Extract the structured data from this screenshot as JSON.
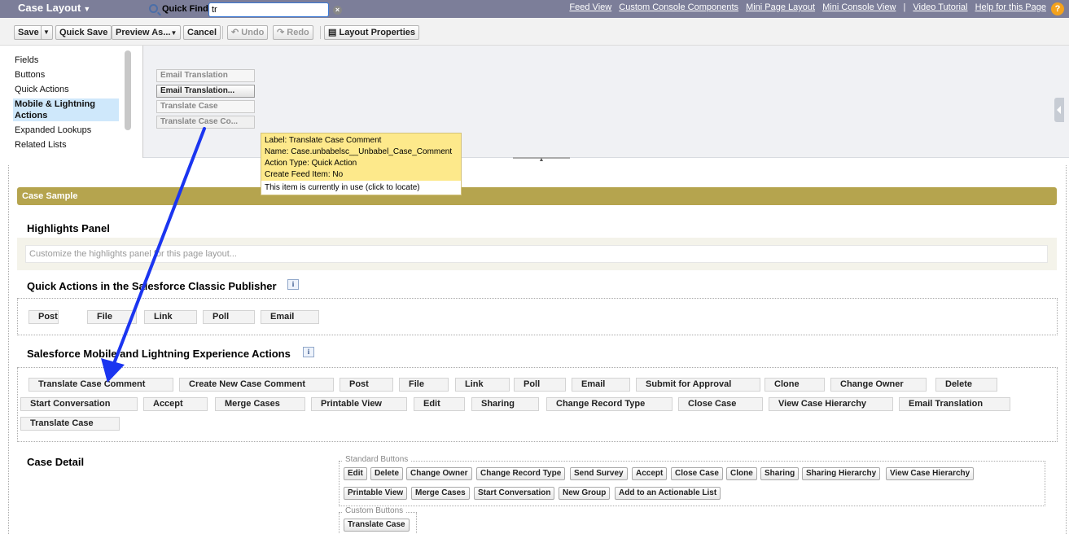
{
  "header": {
    "title": "Case Layout",
    "links": [
      "Feed View",
      "Custom Console Components",
      "Mini Page Layout",
      "Mini Console View"
    ],
    "separator": "|",
    "links2": [
      "Video Tutorial",
      "Help for this Page"
    ],
    "help_glyph": "?"
  },
  "toolbar": {
    "save": "Save",
    "quick_save": "Quick Save",
    "preview_as": "Preview As...",
    "cancel": "Cancel",
    "undo": "Undo",
    "redo": "Redo",
    "layout_properties": "Layout Properties"
  },
  "palette": {
    "categories": [
      "Fields",
      "Buttons",
      "Quick Actions",
      "Mobile & Lightning Actions",
      "Expanded Lookups",
      "Related Lists"
    ],
    "selected_category": "Mobile & Lightning Actions",
    "quick_find_label": "Quick Find",
    "quick_find_value": "tr",
    "items": [
      "Email Translation",
      "Email Translation...",
      "Translate Case",
      "Translate Case Co..."
    ]
  },
  "tooltip": {
    "label": "Label: Translate Case Comment",
    "name": "Name: Case.unbabelsc__Unbabel_Case_Comment",
    "action_type": "Action Type: Quick Action",
    "create_feed": "Create Feed Item: No",
    "footer": "This item is currently in use (click to locate)"
  },
  "layout": {
    "sample_bar": "Case Sample",
    "highlights_title": "Highlights Panel",
    "highlights_placeholder": "Customize the highlights panel for this page layout...",
    "classic_title": "Quick Actions in the Salesforce Classic Publisher",
    "classic_actions": [
      "Post",
      "File",
      "Link",
      "Poll",
      "Email"
    ],
    "mobile_title": "Salesforce Mobile and Lightning Experience Actions",
    "mobile_actions_row1": [
      "Translate Case Comment",
      "Create New Case Comment",
      "Post",
      "File",
      "Link",
      "Poll",
      "Email",
      "Submit for Approval",
      "Clone",
      "Change Owner",
      "Delete"
    ],
    "mobile_actions_row2": [
      "Start Conversation",
      "Accept",
      "Merge Cases",
      "Printable View",
      "Edit",
      "Sharing",
      "Change Record Type",
      "Close Case",
      "View Case Hierarchy",
      "Email Translation"
    ],
    "mobile_actions_row3": [
      "Translate Case"
    ],
    "detail_title": "Case Detail",
    "standard_buttons_legend": "Standard Buttons",
    "standard_buttons_row1": [
      "Edit",
      "Delete",
      "Change Owner",
      "Change Record Type",
      "Send Survey",
      "Accept",
      "Close Case",
      "Clone",
      "Sharing",
      "Sharing Hierarchy",
      "View Case Hierarchy"
    ],
    "standard_buttons_row2": [
      "Printable View",
      "Merge Cases",
      "Start Conversation",
      "New Group",
      "Add to an Actionable List"
    ],
    "custom_buttons_legend": "Custom Buttons",
    "custom_buttons": [
      "Translate Case"
    ]
  },
  "colors": {
    "title_bar": "#7c7e99",
    "section_bar": "#b5a44e",
    "tooltip_bg": "#fde98b",
    "arrow": "#1b35f0",
    "selected_category": "#cfe8fb"
  }
}
